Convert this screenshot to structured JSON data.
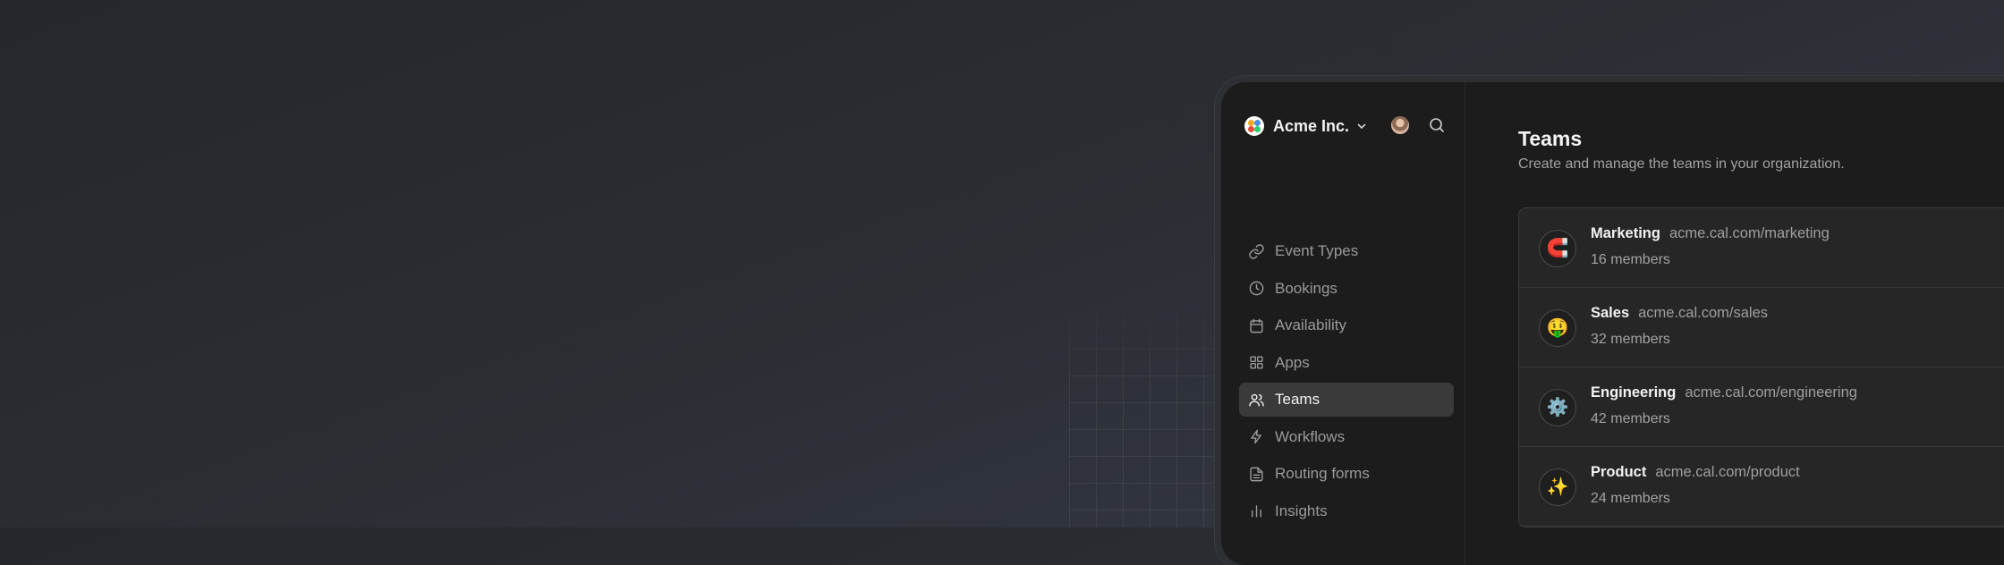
{
  "org": {
    "name": "Acme Inc."
  },
  "sidebar": {
    "items": [
      {
        "label": "Event Types",
        "icon": "link-icon",
        "active": false
      },
      {
        "label": "Bookings",
        "icon": "clock-icon",
        "active": false
      },
      {
        "label": "Availability",
        "icon": "calendar-icon",
        "active": false
      },
      {
        "label": "Apps",
        "icon": "grid-icon",
        "active": false
      },
      {
        "label": "Teams",
        "icon": "users-icon",
        "active": true
      },
      {
        "label": "Workflows",
        "icon": "lightning-icon",
        "active": false
      },
      {
        "label": "Routing forms",
        "icon": "file-text-icon",
        "active": false
      },
      {
        "label": "Insights",
        "icon": "bar-chart-icon",
        "active": false
      }
    ]
  },
  "main": {
    "title": "Teams",
    "subtitle": "Create and manage the teams in your organization.",
    "teams": [
      {
        "name": "Marketing",
        "url": "acme.cal.com/marketing",
        "members": "16 members",
        "emoji": "🧲"
      },
      {
        "name": "Sales",
        "url": "acme.cal.com/sales",
        "members": "32 members",
        "emoji": "🤑"
      },
      {
        "name": "Engineering",
        "url": "acme.cal.com/engineering",
        "members": "42 members",
        "emoji": "⚙️"
      },
      {
        "name": "Product",
        "url": "acme.cal.com/product",
        "members": "24 members",
        "emoji": "✨"
      }
    ]
  },
  "colors": {
    "app_bg": "#1c1c1c",
    "active_nav_bg": "#3a3a3a",
    "text_primary": "#f2f2f2",
    "text_muted": "#9a9a9a",
    "logo_dots": [
      "#f5a623",
      "#4a90e2",
      "#e74c3c",
      "#2ecc71"
    ]
  }
}
